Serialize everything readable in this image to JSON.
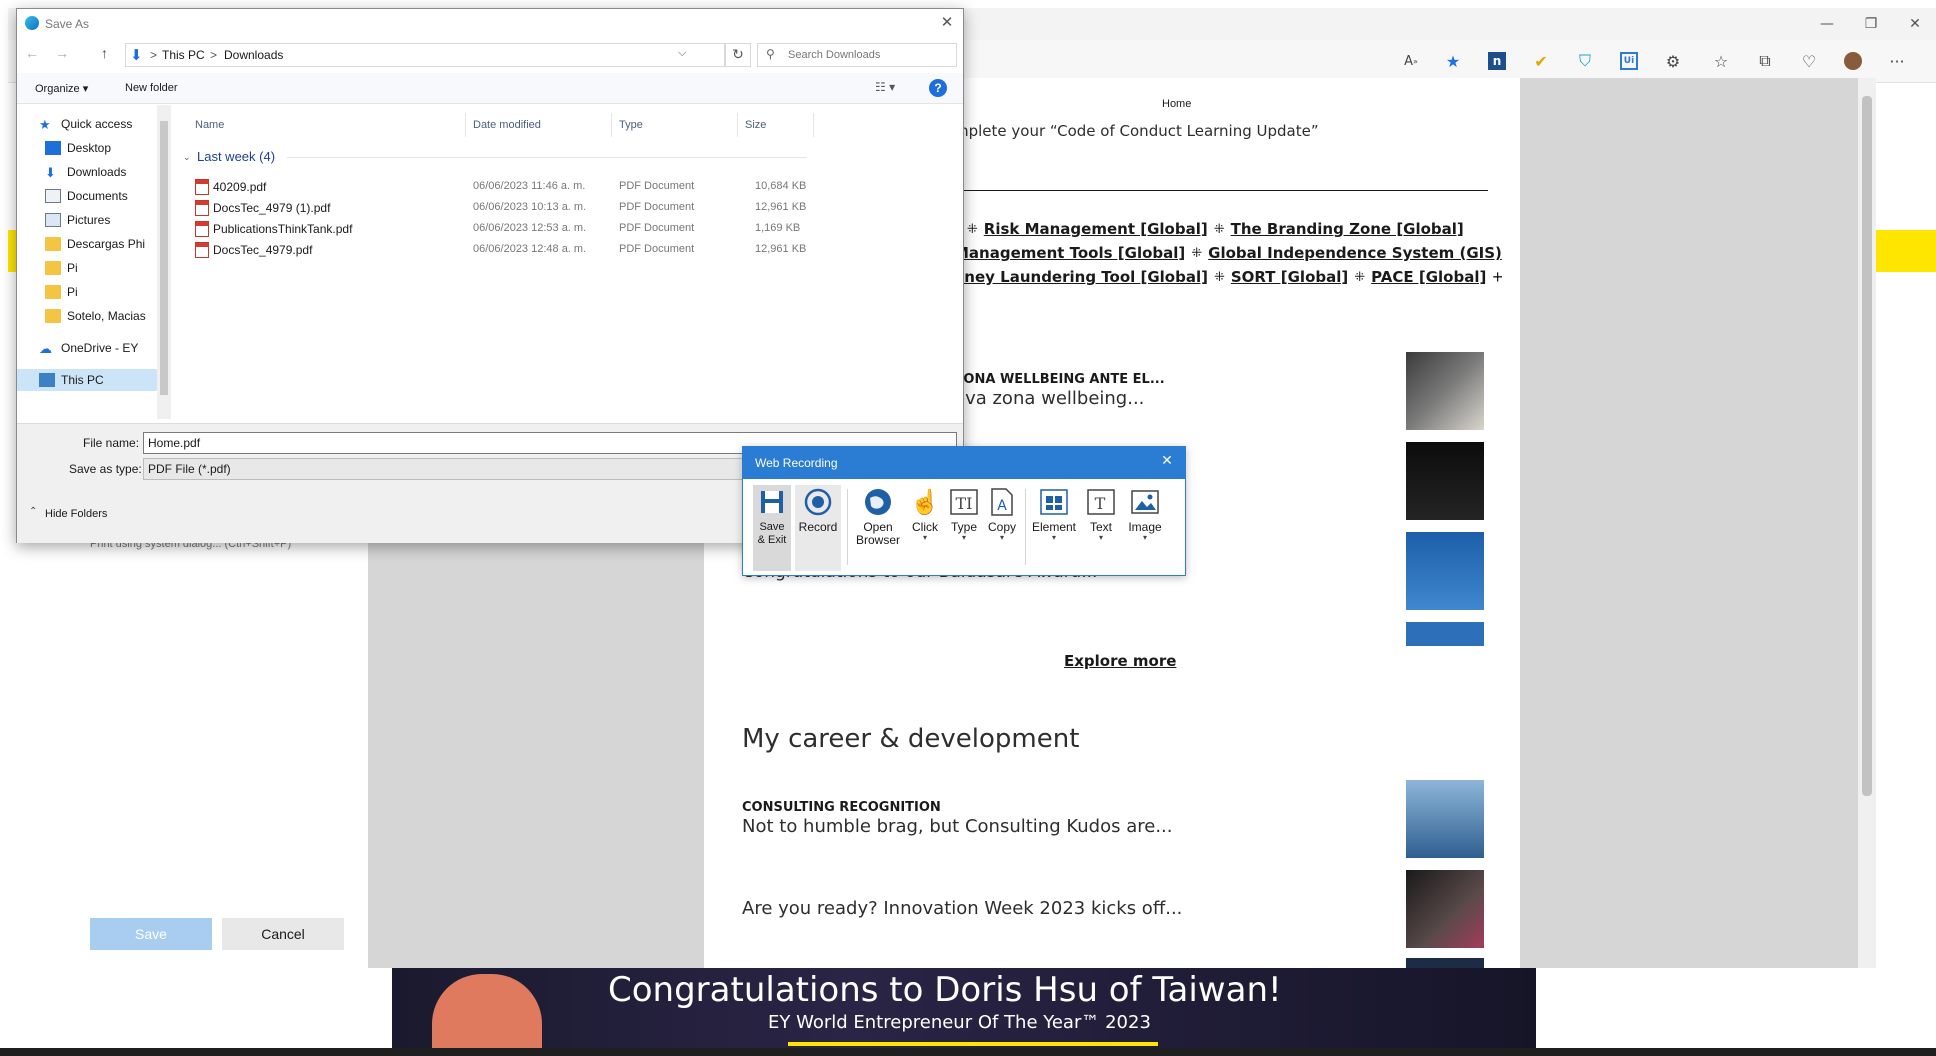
{
  "browser": {
    "window_controls": {
      "minimize": "—",
      "restore": "❐",
      "close": "✕"
    },
    "toolbar_icons": [
      "read-aloud-icon",
      "favorite-star-icon",
      "onenote-extension-icon",
      "check-extension-icon",
      "shield-extension-icon",
      "uipath-extension-icon",
      "extensions-icon",
      "favorites-icon",
      "collections-icon",
      "performance-icon",
      "profile-avatar-icon",
      "more-icon"
    ],
    "more_label": "···"
  },
  "print_panel": {
    "system_dialog_text": "Print using system dialog... (Ctrl+Shift+P)",
    "save_label": "Save",
    "cancel_label": "Cancel"
  },
  "page": {
    "header_home": "Home",
    "intro_text": "mplete your “Code of Conduct Learning Update”",
    "links_row1": [
      "]",
      "Risk Management [Global]",
      "The Branding Zone [Global]"
    ],
    "links_row2": [
      "Management Tools [Global]",
      "Global Independence System (GIS)"
    ],
    "links_row3": [
      "oney Laundering Tool [Global]",
      "SORT [Global]",
      "PACE [Global]"
    ],
    "plus": "+",
    "news1_title": "ZONA WELLBEING ANTE EL...",
    "news1_body": "eva zona wellbeing...",
    "news3_body": "Congratulations to our Baldasare Award...",
    "explore_more": "Explore more",
    "section_title": "My career & development",
    "news4_title": "CONSULTING RECOGNITION",
    "news4_body": "Not to humble brag, but Consulting Kudos are...",
    "news5_body": "Are you ready? Innovation Week 2023 kicks off...",
    "banner_title": "Congratulations to Doris Hsu of Taiwan!",
    "banner_sub": "EY World Entrepreneur Of The Year™ 2023"
  },
  "save_dialog": {
    "title": "Save As",
    "close": "✕",
    "nav_back": "←",
    "nav_forward": "→",
    "nav_up": "↑",
    "breadcrumb": [
      "This PC",
      "Downloads"
    ],
    "breadcrumb_sep": ">",
    "refresh": "↻",
    "search_placeholder": "Search Downloads",
    "organize_label": "Organize ▾",
    "new_folder_label": "New folder",
    "help": "?",
    "nav_items": [
      {
        "label": "Quick access",
        "icon": "star-icon"
      },
      {
        "label": "Desktop",
        "icon": "desktop-icon"
      },
      {
        "label": "Downloads",
        "icon": "download-icon"
      },
      {
        "label": "Documents",
        "icon": "documents-icon"
      },
      {
        "label": "Pictures",
        "icon": "pictures-icon"
      },
      {
        "label": "Descargas Phi",
        "icon": "folder-icon"
      },
      {
        "label": "Pi",
        "icon": "folder-icon"
      },
      {
        "label": "Pi",
        "icon": "folder-icon"
      },
      {
        "label": "Sotelo, Macias",
        "icon": "folder-icon"
      },
      {
        "label": "OneDrive - EY",
        "icon": "cloud-icon"
      },
      {
        "label": "This PC",
        "icon": "computer-icon"
      }
    ],
    "columns": [
      "Name",
      "Date modified",
      "Type",
      "Size"
    ],
    "group_label": "Last week (4)",
    "files": [
      {
        "name": "40209.pdf",
        "date": "06/06/2023 11:46 a. m.",
        "type": "PDF Document",
        "size": "10,684 KB"
      },
      {
        "name": "DocsTec_4979 (1).pdf",
        "date": "06/06/2023 10:13 a. m.",
        "type": "PDF Document",
        "size": "12,961 KB"
      },
      {
        "name": "PublicationsThinkTank.pdf",
        "date": "06/06/2023 12:53 a. m.",
        "type": "PDF Document",
        "size": "1,169 KB"
      },
      {
        "name": "DocsTec_4979.pdf",
        "date": "06/06/2023 12:48 a. m.",
        "type": "PDF Document",
        "size": "12,961 KB"
      }
    ],
    "file_name_label": "File name:",
    "file_name_value": "Home.pdf",
    "save_type_label": "Save as type:",
    "save_type_value": "PDF File (*.pdf)",
    "hide_folders": "Hide Folders"
  },
  "web_recording": {
    "title": "Web Recording",
    "close": "✕",
    "tools": [
      {
        "label": "Save\n& Exit"
      },
      {
        "label": "Record"
      },
      {
        "label": "Open\nBrowser"
      },
      {
        "label": "Click"
      },
      {
        "label": "Type"
      },
      {
        "label": "Copy"
      },
      {
        "label": "Element"
      },
      {
        "label": "Text"
      },
      {
        "label": "Image"
      }
    ]
  },
  "colors": {
    "accent": "#2b7cd3",
    "ey_yellow": "#ffe600"
  }
}
